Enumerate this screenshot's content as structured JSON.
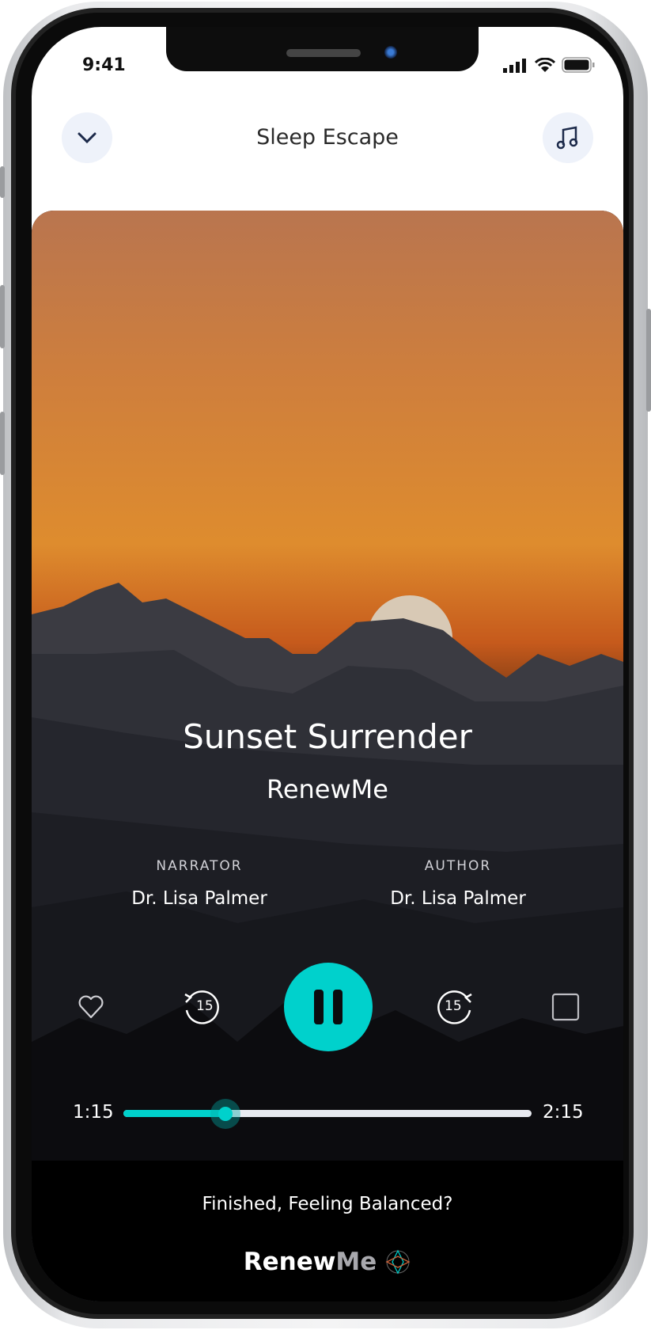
{
  "status_bar": {
    "time": "9:41"
  },
  "header": {
    "title": "Sleep Escape",
    "left_icon": "chevron-down-icon",
    "right_icon": "music-note-icon"
  },
  "track": {
    "title": "Sunset Surrender",
    "brand": "RenewMe"
  },
  "credits": [
    {
      "label": "NARRATOR",
      "name": "Dr. Lisa Palmer"
    },
    {
      "label": "AUTHOR",
      "name": "Dr. Lisa Palmer"
    }
  ],
  "controls": {
    "favorite_icon": "heart-icon",
    "rewind_icon": "rewind-15-icon",
    "rewind_label": "15",
    "play_state_icon": "pause-icon",
    "forward_icon": "forward-15-icon",
    "forward_label": "15",
    "extra_icon": "square-icon"
  },
  "progress": {
    "elapsed": "1:15",
    "total": "2:15",
    "fraction": 0.25
  },
  "finish_prompt": "Finished, Feeling Balanced?",
  "footer_logo": {
    "text_primary": "Renew",
    "text_secondary": "Me"
  },
  "colors": {
    "accent": "#00d1cc",
    "header_button_bg": "#eef2fa",
    "icon_dark": "#1c2a4a"
  }
}
